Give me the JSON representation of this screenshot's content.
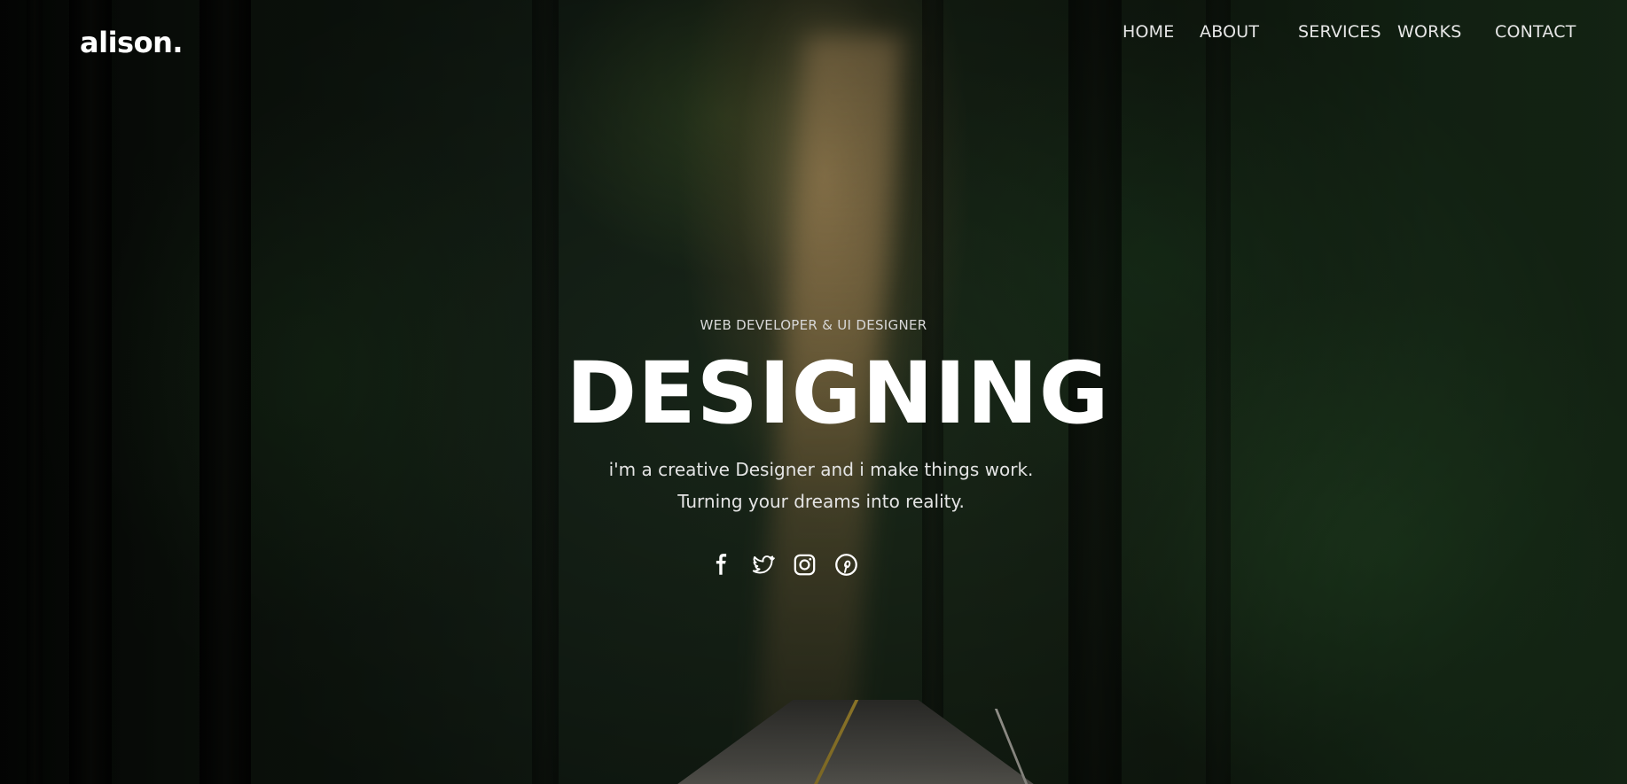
{
  "brand": {
    "logo_text": "alison."
  },
  "nav": {
    "items": [
      {
        "label": "HOME"
      },
      {
        "label": "ABOUT"
      },
      {
        "label": "SERVICES"
      },
      {
        "label": "WORKS"
      },
      {
        "label": "CONTACT"
      }
    ]
  },
  "hero": {
    "subtitle": "WEB DEVELOPER & UI DESIGNER",
    "headline": "DESIGNING",
    "tagline_line1": "i'm a creative Designer and i make things work.",
    "tagline_line2": "Turning your dreams into reality.",
    "social_icons": [
      "facebook-icon",
      "twitter-icon",
      "instagram-icon",
      "pinterest-icon"
    ]
  },
  "colors": {
    "text": "#ffffff",
    "nav_text": "#e6e6e6",
    "light_ray": "#d7af73"
  }
}
